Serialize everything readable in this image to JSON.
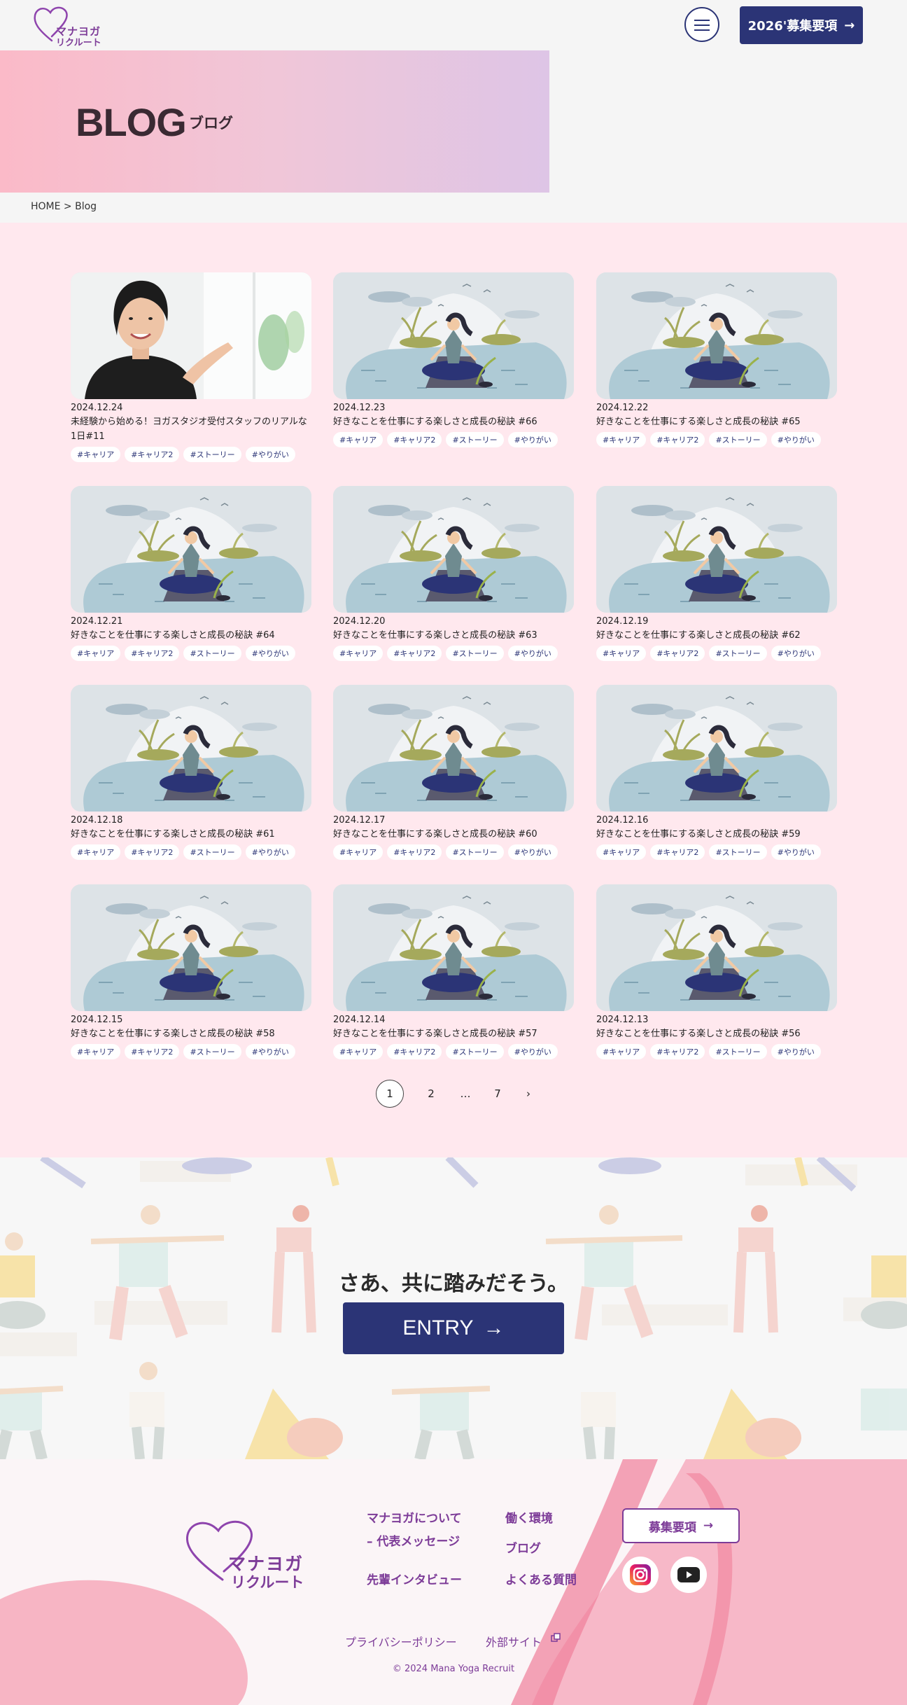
{
  "header": {
    "logo_line1": "マナヨガ",
    "logo_line2": "リクルート",
    "recruit_button": "2026'募集要項",
    "arrow": "→"
  },
  "hero": {
    "title": "BLOG",
    "subtitle": "ブログ"
  },
  "breadcrumb": "HOME > Blog",
  "posts": [
    {
      "date": "2024.12.24",
      "title": "未経験から始める！ヨガスタジオ受付スタッフのリアルな1日#11",
      "image": "person-photo"
    },
    {
      "date": "2024.12.23",
      "title": "好きなことを仕事にする楽しさと成長の秘訣 #66",
      "image": "yoga-illustration"
    },
    {
      "date": "2024.12.22",
      "title": "好きなことを仕事にする楽しさと成長の秘訣 #65",
      "image": "yoga-illustration"
    },
    {
      "date": "2024.12.21",
      "title": "好きなことを仕事にする楽しさと成長の秘訣 #64",
      "image": "yoga-illustration"
    },
    {
      "date": "2024.12.20",
      "title": "好きなことを仕事にする楽しさと成長の秘訣 #63",
      "image": "yoga-illustration"
    },
    {
      "date": "2024.12.19",
      "title": "好きなことを仕事にする楽しさと成長の秘訣 #62",
      "image": "yoga-illustration"
    },
    {
      "date": "2024.12.18",
      "title": "好きなことを仕事にする楽しさと成長の秘訣 #61",
      "image": "yoga-illustration"
    },
    {
      "date": "2024.12.17",
      "title": "好きなことを仕事にする楽しさと成長の秘訣 #60",
      "image": "yoga-illustration"
    },
    {
      "date": "2024.12.16",
      "title": "好きなことを仕事にする楽しさと成長の秘訣 #59",
      "image": "yoga-illustration"
    },
    {
      "date": "2024.12.15",
      "title": "好きなことを仕事にする楽しさと成長の秘訣 #58",
      "image": "yoga-illustration"
    },
    {
      "date": "2024.12.14",
      "title": "好きなことを仕事にする楽しさと成長の秘訣 #57",
      "image": "yoga-illustration"
    },
    {
      "date": "2024.12.13",
      "title": "好きなことを仕事にする楽しさと成長の秘訣 #56",
      "image": "yoga-illustration"
    }
  ],
  "tags": [
    "#キャリア",
    "#キャリア2",
    "#ストーリー",
    "#やりがい"
  ],
  "pagination": {
    "pages": [
      "1",
      "2",
      "…",
      "7"
    ],
    "next": "›",
    "current": "1"
  },
  "entry": {
    "copy": "さあ、共に踏みだそう。",
    "button": "ENTRY",
    "arrow": "→"
  },
  "footer": {
    "logo_line1": "マナヨガ",
    "logo_line2": "リクルート",
    "nav": {
      "about": "マナヨガについて",
      "message": "– 代表メッセージ",
      "interview": "先輩インタビュー",
      "environment": "働く環境",
      "blog": "ブログ",
      "faq": "よくある質問"
    },
    "recruit_button": "募集要項",
    "arrow": "→",
    "privacy": "プライバシーポリシー",
    "external": "外部サイト",
    "copyright": "© 2024 Mana Yoga Recruit"
  },
  "colors": {
    "navy": "#2b3476",
    "purple": "#7d3c98",
    "pink_bg": "#ffe8ee"
  }
}
